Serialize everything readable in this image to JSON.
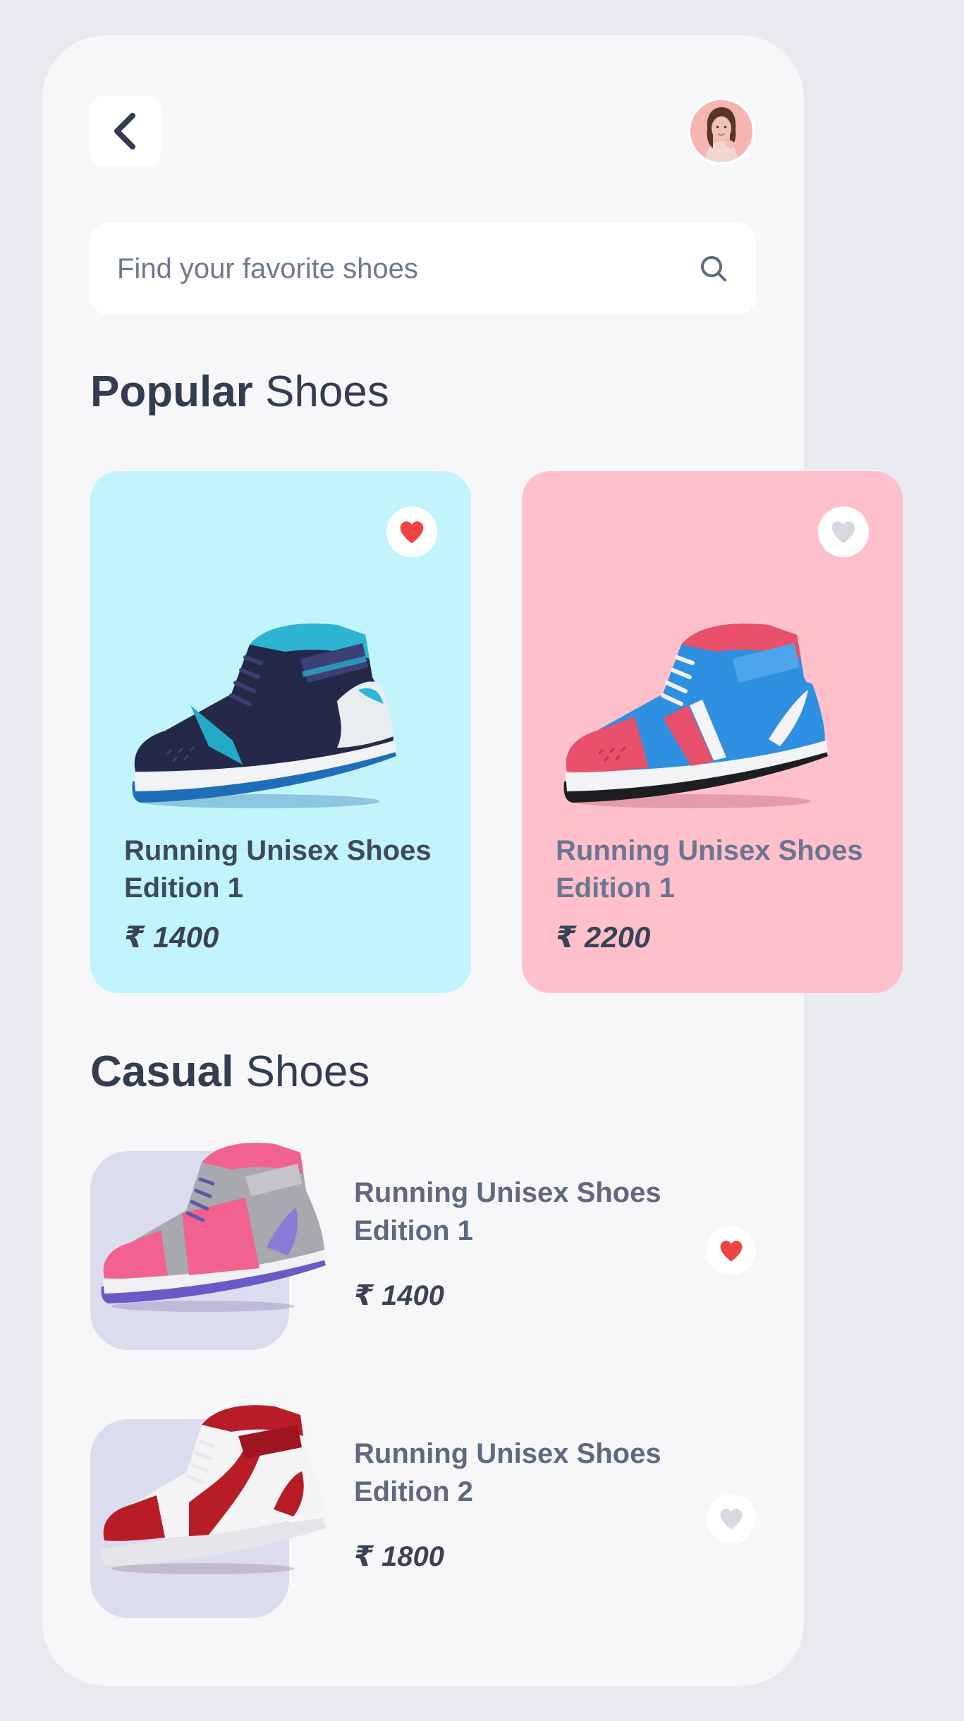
{
  "colors": {
    "page_background": "#E9E9F2",
    "screen_background": "#F7F7F9",
    "heading_text": "#333D52",
    "muted_text": "#5E6A82",
    "favorite_active": "#EE4444",
    "favorite_inactive": "#D6D9E2"
  },
  "header": {
    "back_icon": "chevron-left-icon",
    "avatar": "user-avatar-photo"
  },
  "search": {
    "placeholder": "Find your favorite shoes",
    "icon": "search-icon"
  },
  "popular": {
    "title_bold": "Popular",
    "title_rest": " Shoes",
    "cards": [
      {
        "name": "Running Unisex Shoes Edition 1",
        "price": "₹ 1400",
        "favorite": true,
        "background": "#C2F4FC",
        "name_color": "#3E4A5E"
      },
      {
        "name": "Running Unisex Shoes Edition 1",
        "price": "₹ 2200",
        "favorite": false,
        "background": "#FEC1CB",
        "name_color": "#6C7592"
      }
    ]
  },
  "casual": {
    "title_bold": "Casual",
    "title_rest": " Shoes",
    "items": [
      {
        "name": "Running Unisex Shoes Edition 1",
        "price": "₹ 1400",
        "favorite": true
      },
      {
        "name": "Running Unisex Shoes Edition 2",
        "price": "₹ 1800",
        "favorite": false
      }
    ]
  }
}
